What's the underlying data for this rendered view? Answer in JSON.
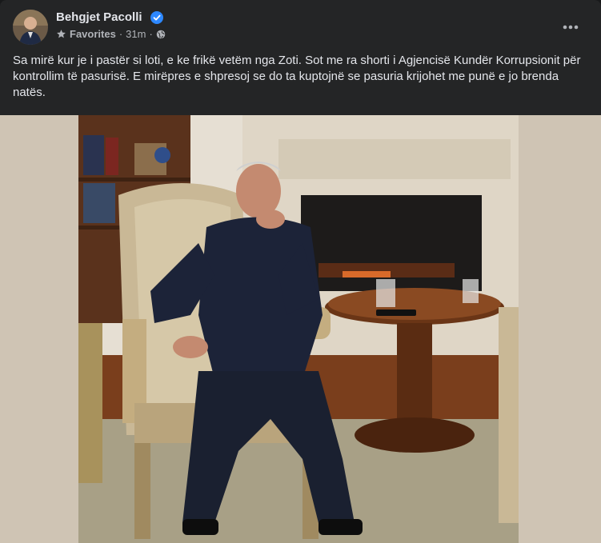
{
  "post": {
    "author": "Behgjet Pacolli",
    "audience_label": "Favorites",
    "time": "31m",
    "separator": "·",
    "caption": "Sa mirë kur je i pastër si loti, e ke frikë vetëm nga Zoti. Sot me ra shorti i Agjencisë Kundër Korrupsionit për kontrollim të pasurisë. E mirëpres e shpresoj se do ta kuptojnë se pasuria krijohet me punë e jo brenda natës."
  },
  "icons": {
    "verified": "verified-badge-icon",
    "favorites": "star-icon",
    "audience": "globe-icon",
    "more": "more-horizontal-icon"
  },
  "colors": {
    "background": "#18191a",
    "card": "#242526",
    "text_primary": "#e4e6eb",
    "text_secondary": "#b0b3b8",
    "verified": "#2d88ff"
  }
}
